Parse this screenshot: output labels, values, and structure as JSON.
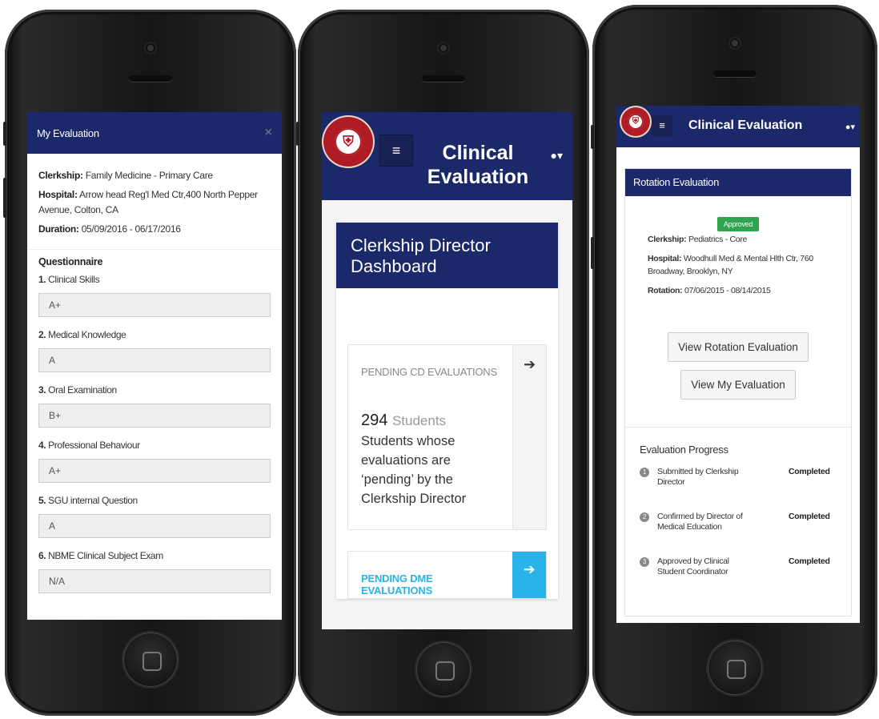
{
  "phone1": {
    "header_title": "My Evaluation",
    "close_glyph": "×",
    "info": {
      "clerkship_label": "Clerkship:",
      "clerkship_value": "Family Medicine - Primary Care",
      "hospital_label": "Hospital:",
      "hospital_value": "Arrow head Reg'l Med Ctr,400 North Pepper Avenue, Colton, CA",
      "duration_label": "Duration:",
      "duration_value": "05/09/2016 - 06/17/2016"
    },
    "questionnaire_title": "Questionnaire",
    "questions": [
      {
        "num": "1.",
        "label": "Clinical Skills",
        "answer": "A+"
      },
      {
        "num": "2.",
        "label": "Medical Knowledge",
        "answer": "A"
      },
      {
        "num": "3.",
        "label": "Oral Examination",
        "answer": "B+"
      },
      {
        "num": "4.",
        "label": "Professional Behaviour",
        "answer": "A+"
      },
      {
        "num": "5.",
        "label": "SGU internal Question",
        "answer": "A"
      },
      {
        "num": "6.",
        "label": "NBME Clinical Subject Exam",
        "answer": "N/A"
      }
    ]
  },
  "phone2": {
    "logo_glyph": "⛨",
    "menu_glyph": "≡",
    "header_title": "Clinical Evaluation",
    "user_glyph": "▾",
    "dashboard_title": "Clerkship Director Dashboard",
    "pending_cd": {
      "label": "PENDING CD EVALUATIONS",
      "arrow": "➔",
      "count": "294",
      "unit": "Students",
      "description": "Students whose evaluations are ‘pending’ by the Clerkship Director"
    },
    "pending_dme": {
      "label": "PENDING DME EVALUATIONS",
      "arrow": "➔"
    }
  },
  "phone3": {
    "logo_glyph": "⛨",
    "menu_glyph": "≡",
    "header_title": "Clinical Evaluation",
    "user_glyph": "▾",
    "card_title": "Rotation Evaluation",
    "badge": "Approved",
    "clerkship_label": "Clerkship:",
    "clerkship_value": "Pediatrics - Core",
    "hospital_label": "Hospital:",
    "hospital_value": "Woodhull Med & Mental Hlth Ctr, 760 Broadway, Brooklyn, NY",
    "rotation_label": "Rotation:",
    "rotation_value": "07/06/2015 - 08/14/2015",
    "btn_view_rotation": "View Rotation Evaluation",
    "btn_view_my": "View My Evaluation",
    "progress_title": "Evaluation Progress",
    "steps": [
      {
        "num": "1",
        "text": "Submitted by Clerkship Director",
        "status": "Completed"
      },
      {
        "num": "2",
        "text": "Confirmed by Director of Medical Education",
        "status": "Completed"
      },
      {
        "num": "3",
        "text": "Approved by Clinical Student Coordinator",
        "status": "Completed"
      }
    ]
  }
}
